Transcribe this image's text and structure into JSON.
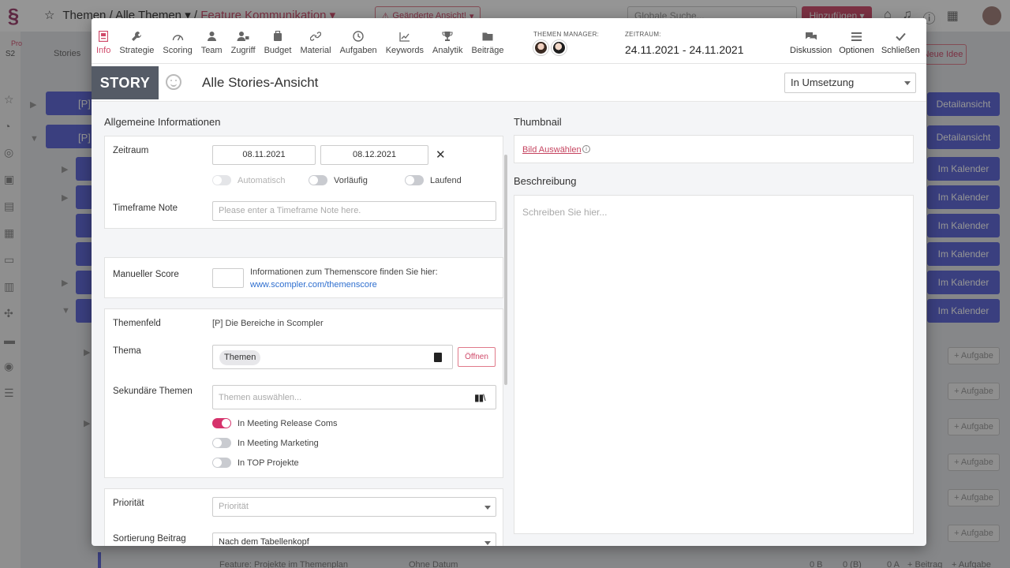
{
  "background": {
    "breadcrumb": {
      "root": "Themen",
      "sep": "/",
      "level1": "Alle Themen",
      "level2": "Feature Kommunikation"
    },
    "changed_view": "Geänderte Ansicht!",
    "search_placeholder": "Globale Suche...",
    "add_label": "Hinzufügen",
    "sidebar_badge_pro": "Pro",
    "sidebar_badge_s2": "S2",
    "stories_label": "Stories",
    "new_idea": "Neue Idee",
    "row_prefix": "[P]",
    "detail_label": "Detailansicht",
    "calendar_label": "Im Kalender",
    "task_label": "+ Aufgabe",
    "bottom_row": {
      "title": "Feature: Projekte im Themenplan",
      "date": "Ohne Datum",
      "c1": "0 B",
      "c2": "0 (B)",
      "c3": "0 A",
      "post_label": "+ Beitrag"
    }
  },
  "tabs": [
    {
      "label": "Info",
      "icon": "info-icon",
      "active": true
    },
    {
      "label": "Strategie",
      "icon": "wrench-icon"
    },
    {
      "label": "Scoring",
      "icon": "gauge-icon"
    },
    {
      "label": "Team",
      "icon": "team-icon"
    },
    {
      "label": "Zugriff",
      "icon": "access-icon"
    },
    {
      "label": "Budget",
      "icon": "budget-icon"
    },
    {
      "label": "Material",
      "icon": "link-icon"
    },
    {
      "label": "Aufgaben",
      "icon": "clock-icon"
    },
    {
      "label": "Keywords",
      "icon": "chart-icon"
    },
    {
      "label": "Analytik",
      "icon": "trophy-icon"
    },
    {
      "label": "Beiträge",
      "icon": "folder-icon"
    }
  ],
  "manager_label": "THEMEN MANAGER:",
  "period_label": "ZEITRAUM:",
  "period_value": "24.11.2021 - 24.11.2021",
  "actions": [
    {
      "label": "Diskussion",
      "icon": "discussion-icon"
    },
    {
      "label": "Optionen",
      "icon": "menu-icon"
    },
    {
      "label": "Schließen",
      "icon": "check-icon"
    }
  ],
  "story": {
    "badge": "STORY",
    "title": "Alle Stories-Ansicht",
    "status": "In Umsetzung"
  },
  "general": {
    "section_title": "Allgemeine Informationen",
    "zeitraum": {
      "label": "Zeitraum",
      "start": "08.11.2021",
      "end": "08.12.2021"
    },
    "toggles_period": [
      {
        "label": "Automatisch",
        "state": "disabled"
      },
      {
        "label": "Vorläufig",
        "state": "off"
      },
      {
        "label": "Laufend",
        "state": "off"
      }
    ],
    "timeframe_note": {
      "label": "Timeframe Note",
      "placeholder": "Please enter a Timeframe Note here."
    },
    "score": {
      "label": "Manueller Score",
      "info": "Informationen zum Themenscore finden Sie hier:",
      "link": "www.scompler.com/themenscore"
    },
    "themenfeld": {
      "label": "Themenfeld",
      "value": "[P] Die Bereiche in Scompler"
    },
    "thema": {
      "label": "Thema",
      "chip": "Themen",
      "open_label": "Öffnen"
    },
    "secondary": {
      "label": "Sekundäre Themen",
      "placeholder": "Themen auswählen..."
    },
    "toggles_meeting": [
      {
        "label": "In Meeting Release Coms",
        "state": "on"
      },
      {
        "label": "In Meeting Marketing",
        "state": "off"
      },
      {
        "label": "In TOP Projekte",
        "state": "off"
      }
    ],
    "priority": {
      "label": "Priorität",
      "placeholder": "Priorität"
    },
    "sort": {
      "label": "Sortierung Beitrag",
      "value": "Nach dem Tabellenkopf"
    }
  },
  "thumbnail": {
    "title": "Thumbnail",
    "select_label": "Bild Auswählen"
  },
  "description": {
    "title": "Beschreibung",
    "placeholder": "Schreiben Sie hier..."
  },
  "colors": {
    "accent": "#d04a6a",
    "primary": "#5a63d8",
    "badge": "#555b66"
  }
}
